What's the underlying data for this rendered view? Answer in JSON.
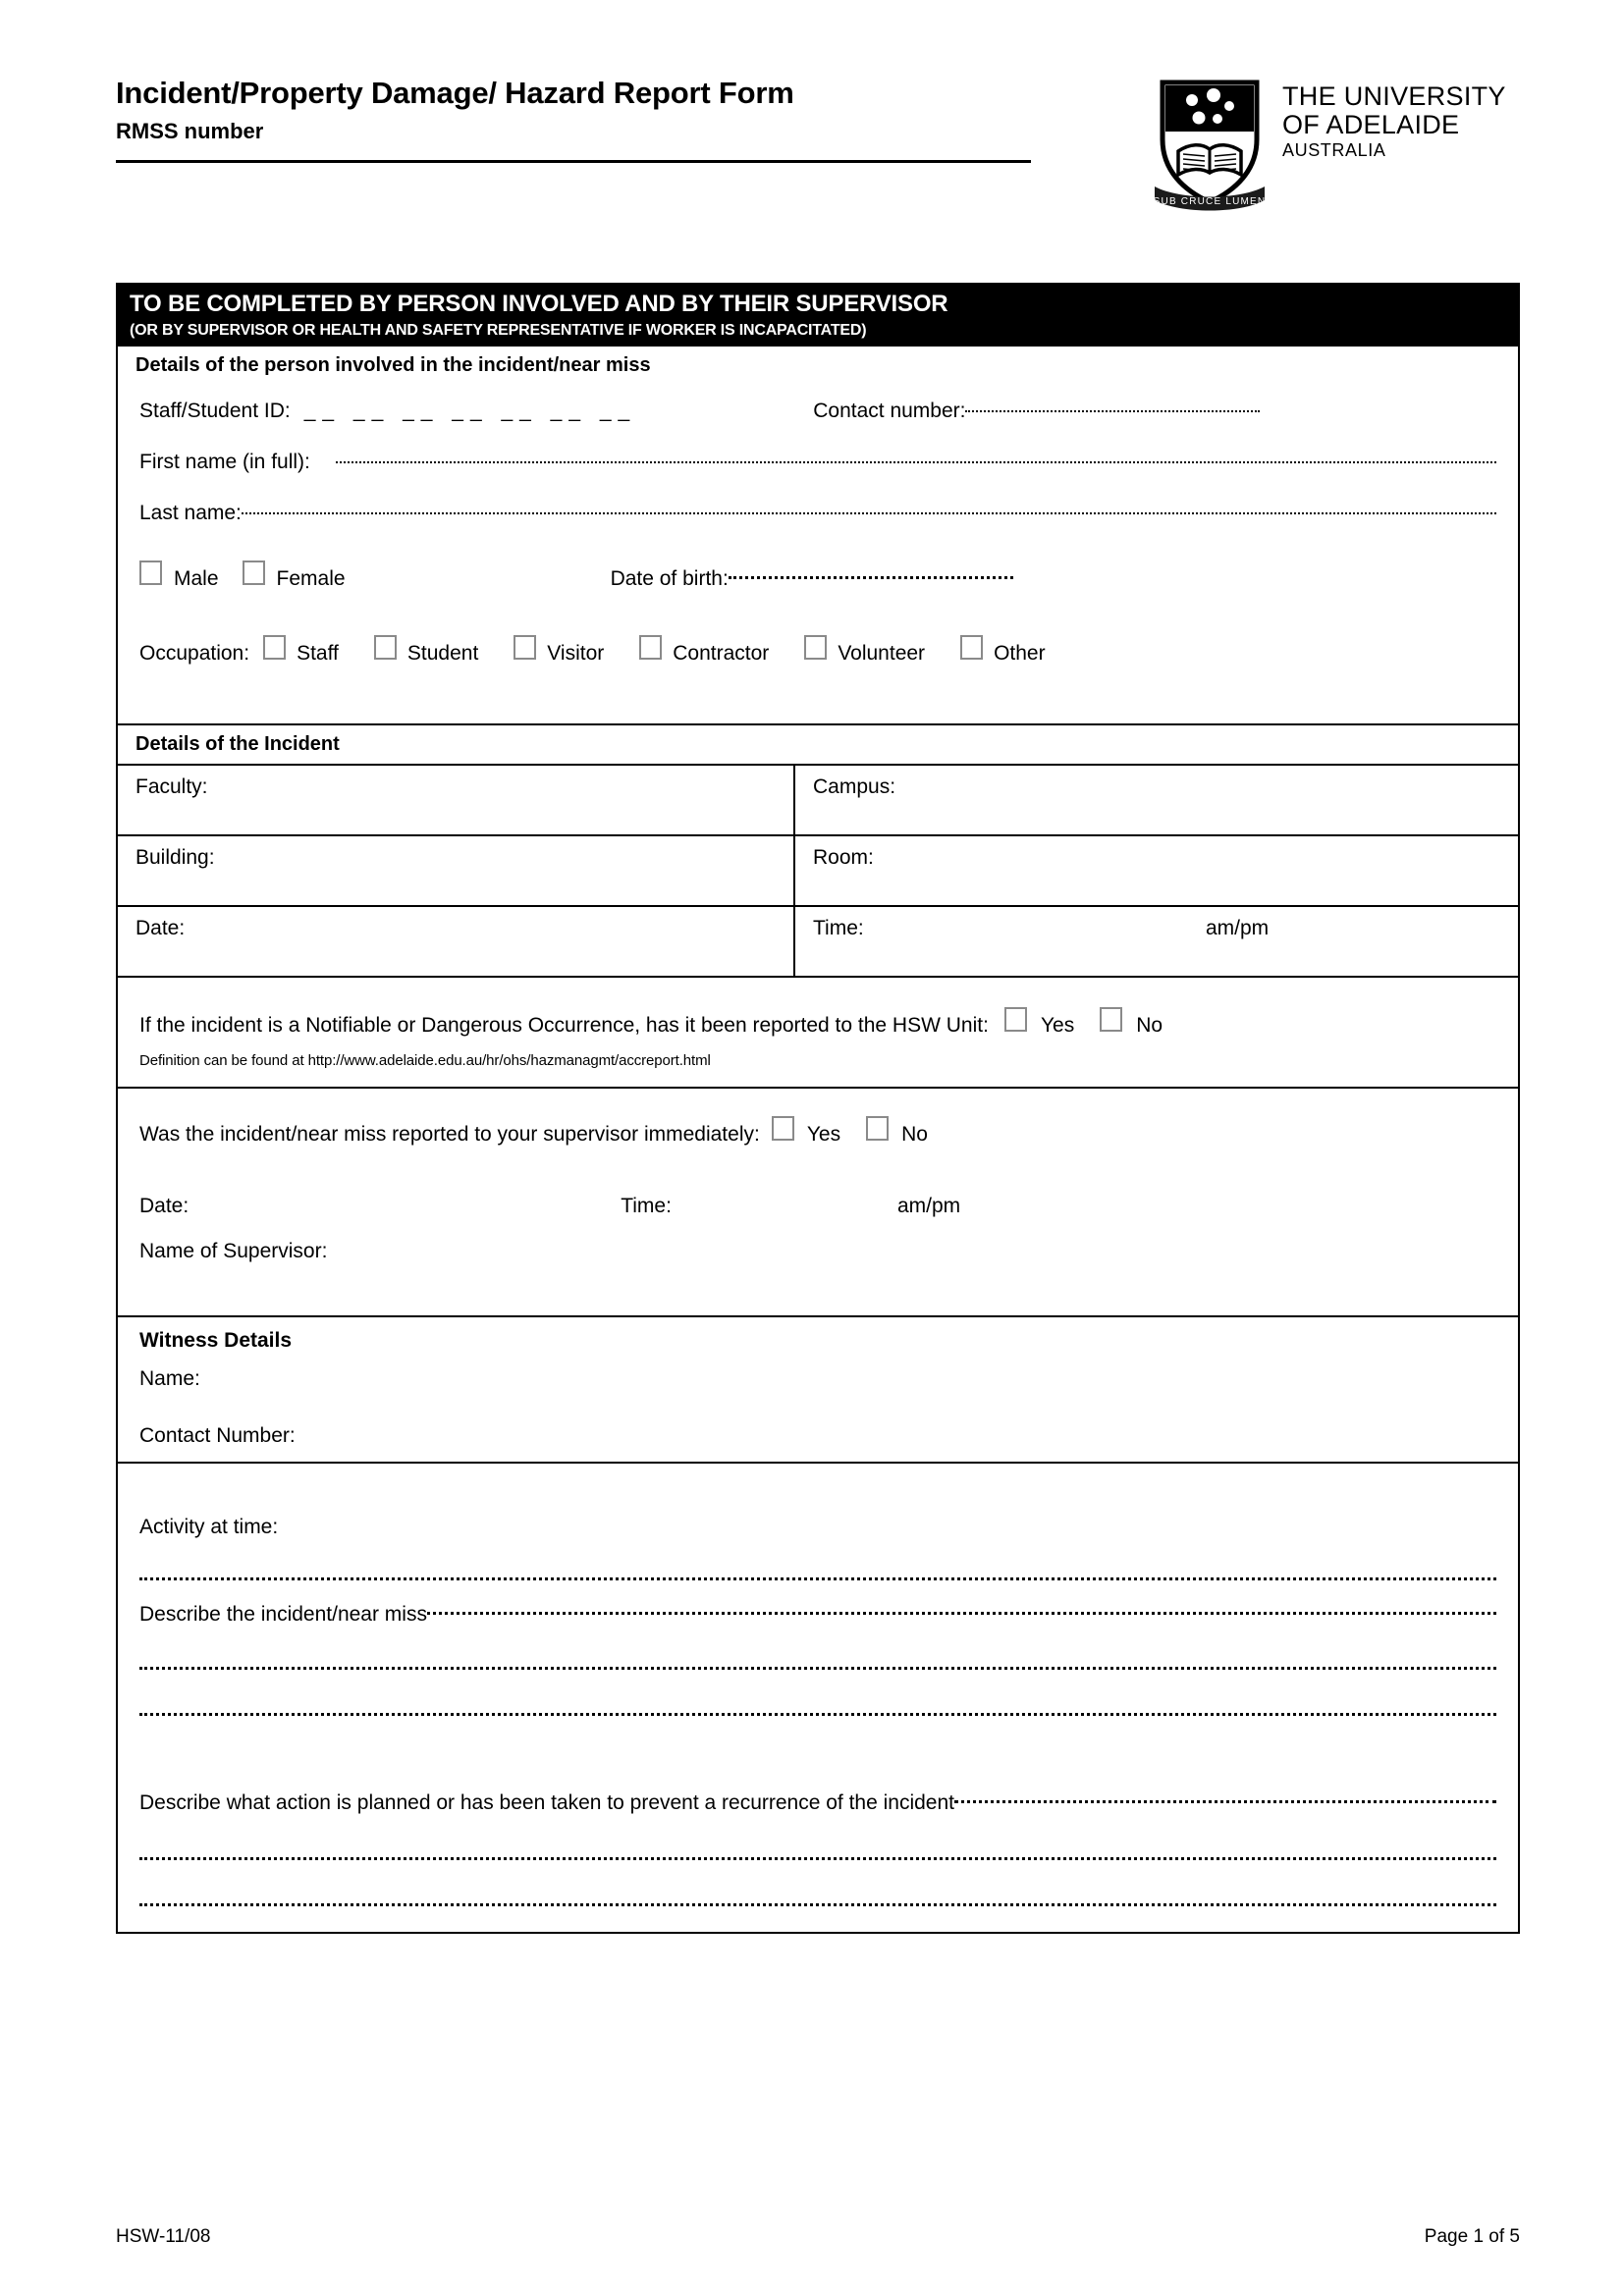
{
  "header": {
    "title": "Incident/Property Damage/ Hazard Report Form",
    "rmss_label": "RMSS number"
  },
  "logo": {
    "line1": "THE UNIVERSITY",
    "line2": "OF ADELAIDE",
    "line3": "AUSTRALIA",
    "motto": "SUB CRUCE LUMEN"
  },
  "band": {
    "line1": "TO BE COMPLETED BY PERSON INVOLVED AND BY THEIR SUPERVISOR",
    "line2": "(OR BY SUPERVISOR OR HEALTH AND SAFETY REPRESENTATIVE IF WORKER IS INCAPACITATED)"
  },
  "person": {
    "section_title": "Details of the person involved in the incident/near miss",
    "staff_id_label": "Staff/Student ID:",
    "staff_id_blanks": "__ __ __ __ __ __ __",
    "contact_label": "Contact number:",
    "first_name_label": "First name (in full):",
    "last_name_label": "Last name:",
    "male_label": "Male",
    "female_label": "Female",
    "dob_label": "Date of birth:",
    "occupation_label": "Occupation:",
    "occupations": [
      "Staff",
      "Student",
      "Visitor",
      "Contractor",
      "Volunteer",
      "Other"
    ]
  },
  "incident": {
    "section_title": "Details of the Incident",
    "faculty_label": "Faculty:",
    "campus_label": "Campus:",
    "building_label": "Building:",
    "room_label": "Room:",
    "date_label": "Date:",
    "time_label": "Time:",
    "ampm_label": "am/pm"
  },
  "notifiable": {
    "question": "If the incident is a Notifiable or Dangerous Occurrence, has it been reported to the HSW Unit:",
    "yes_label": "Yes",
    "no_label": "No",
    "definition": "Definition can be found at http://www.adelaide.edu.au/hr/ohs/hazmanagmt/accreport.html"
  },
  "supervisor": {
    "question": "Was the incident/near miss reported to your supervisor immediately:",
    "yes_label": "Yes",
    "no_label": "No",
    "date_label": "Date:",
    "time_label": "Time:",
    "ampm_label": "am/pm",
    "name_label": "Name of Supervisor:"
  },
  "witness": {
    "section_title": "Witness Details",
    "name_label": "Name:",
    "contact_label": "Contact Number:"
  },
  "narrative": {
    "activity_label": "Activity at time:",
    "describe_incident_label": "Describe the incident/near miss",
    "describe_action_label": "Describe what action is planned or has been taken to prevent a recurrence of the incident"
  },
  "footer": {
    "doc_code": "HSW-11/08",
    "page_number": "Page 1 of 5"
  },
  "colors": {
    "ink": "#000000",
    "paper": "#ffffff",
    "checkbox_border": "#8a8a8a"
  }
}
